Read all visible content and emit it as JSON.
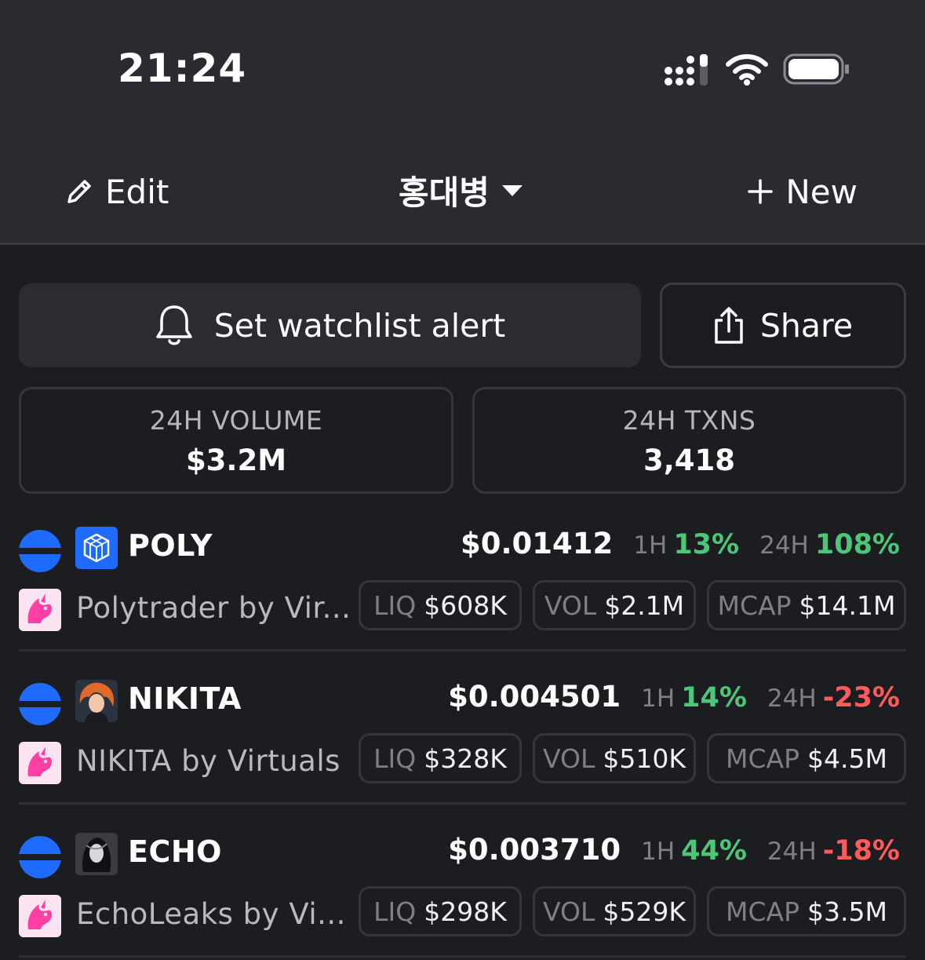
{
  "status_bar": {
    "time": "21:24"
  },
  "nav": {
    "edit_label": "Edit",
    "watchlist_title": "홍대병",
    "new_label": "New"
  },
  "actions": {
    "alert_label": "Set watchlist alert",
    "share_label": "Share"
  },
  "stats": {
    "volume": {
      "label": "24H VOLUME",
      "value": "$3.2M"
    },
    "txns": {
      "label": "24H TXNS",
      "value": "3,418"
    }
  },
  "tokens": [
    {
      "symbol": "POLY",
      "name": "Polytrader by Vir...",
      "price": "$0.01412",
      "h1_label": "1H",
      "h1_change": "13%",
      "h24_label": "24H",
      "h24_change": "108%",
      "liq_label": "LIQ",
      "liq": "$608K",
      "vol_label": "VOL",
      "vol": "$2.1M",
      "mcap_label": "MCAP",
      "mcap": "$14.1M"
    },
    {
      "symbol": "NIKITA",
      "name": "NIKITA by Virtuals",
      "price": "$0.004501",
      "h1_label": "1H",
      "h1_change": "14%",
      "h24_label": "24H",
      "h24_change": "-23%",
      "liq_label": "LIQ",
      "liq": "$328K",
      "vol_label": "VOL",
      "vol": "$510K",
      "mcap_label": "MCAP",
      "mcap": "$4.5M"
    },
    {
      "symbol": "ECHO",
      "name": "EchoLeaks by Vi...",
      "price": "$0.003710",
      "h1_label": "1H",
      "h1_change": "44%",
      "h24_label": "24H",
      "h24_change": "-18%",
      "liq_label": "LIQ",
      "liq": "$298K",
      "vol_label": "VOL",
      "vol": "$529K",
      "mcap_label": "MCAP",
      "mcap": "$3.5M"
    }
  ],
  "icons": {
    "chain": "base-chain-icon",
    "dex": "uniswap-unicorn-icon",
    "edit": "pencil-icon",
    "dropdown": "caret-down-icon",
    "new": "plus-icon",
    "alert": "bell-icon",
    "share": "share-icon"
  },
  "colors": {
    "background": "#1c1d21",
    "header": "#2a2b30",
    "positive": "#4cc779",
    "negative": "#ff5b5b",
    "chain_blue": "#1f6bff"
  }
}
